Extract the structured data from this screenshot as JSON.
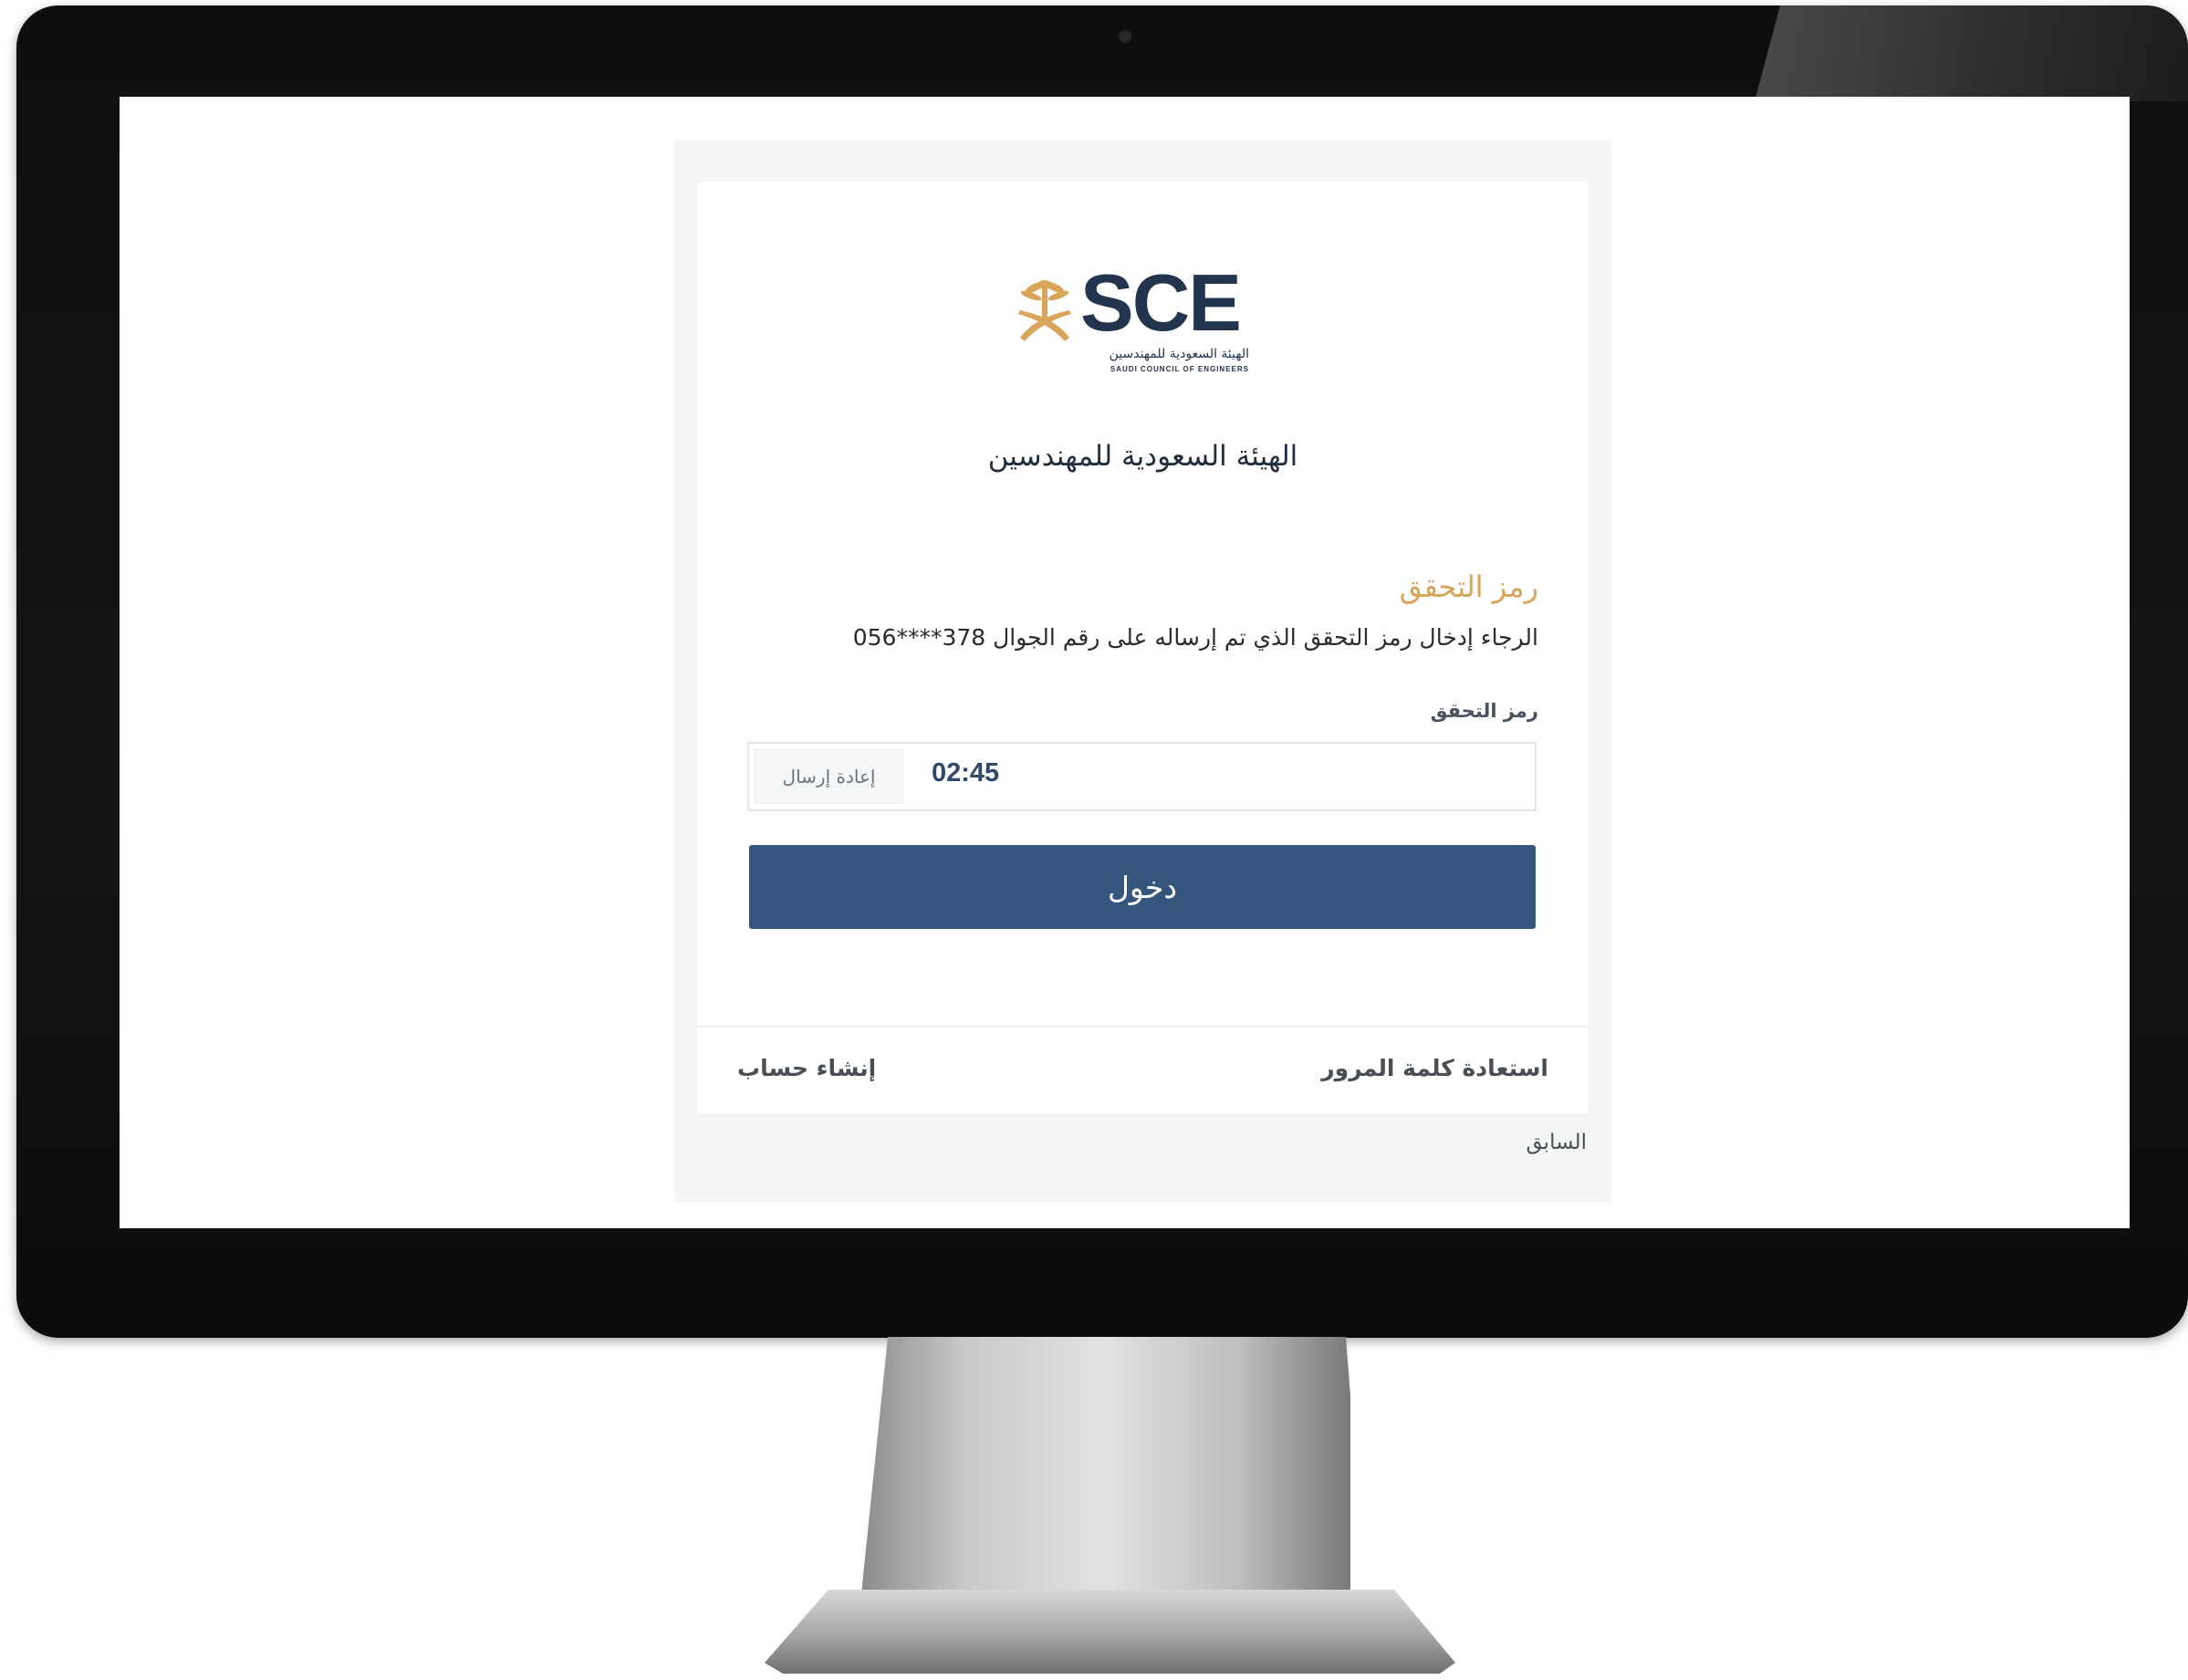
{
  "logo": {
    "letters": "SCE",
    "name_ar": "الهيئة السعودية للمهندسين",
    "name_en": "SAUDI COUNCIL OF ENGINEERS",
    "brand_gold": "#d9a55a",
    "brand_navy": "#22344e"
  },
  "org_title": "الهيئة السعودية للمهندسين",
  "otp": {
    "heading": "رمز التحقق",
    "instruction": "الرجاء إدخال رمز التحقق الذي تم إرساله على رقم الجوال 378****056",
    "field_label": "رمز التحقق",
    "value": "",
    "timer": "02:45",
    "resend_label": "إعادة إرسال"
  },
  "login_button": "دخول",
  "footer": {
    "recover_password": "استعادة كلمة المرور",
    "create_account": "إنشاء حساب"
  },
  "back_link": "السابق",
  "colors": {
    "primary_button": "#34567c",
    "heading_accent": "#d9a55a"
  }
}
